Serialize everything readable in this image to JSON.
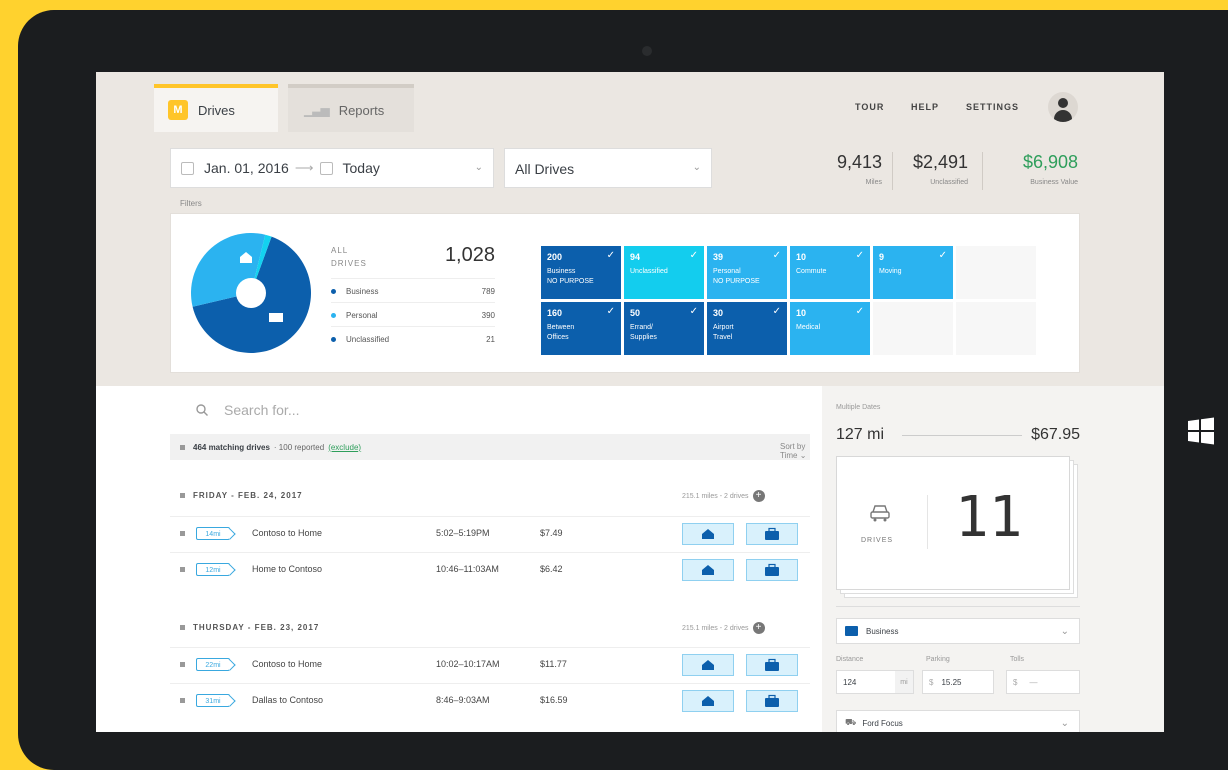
{
  "tabs": [
    {
      "label": "Drives",
      "badge": "M",
      "active": true
    },
    {
      "label": "Reports",
      "active": false
    }
  ],
  "nav": {
    "tour": "TOUR",
    "help": "HELP",
    "settings": "SETTINGS"
  },
  "filters": {
    "start_date": "Jan. 01, 2016",
    "end_date": "Today",
    "drive_filter": "All Drives",
    "label": "Filters"
  },
  "stats": [
    {
      "value": "9,413",
      "label": "Miles"
    },
    {
      "value": "$2,491",
      "label": "Unclassified"
    },
    {
      "value": "$6,908",
      "label": "Business Value"
    }
  ],
  "summary": {
    "all_drives_label_1": "ALL",
    "all_drives_label_2": "DRIVES",
    "total": "1,028",
    "legend": [
      {
        "label": "Business",
        "count": "789",
        "color": "#0C5FAC"
      },
      {
        "label": "Personal",
        "count": "390",
        "color": "#2BB3F0"
      },
      {
        "label": "Unclassified",
        "count": "21",
        "color": "#0C5FAC"
      }
    ],
    "pie": [
      {
        "label": "Business",
        "value": 789,
        "color": "#0C5FAC"
      },
      {
        "label": "Personal",
        "value": 390,
        "color": "#2BB3F0"
      },
      {
        "label": "Unclassified",
        "value": 21,
        "color": "#13D2F0"
      }
    ]
  },
  "tiles": [
    {
      "num": "200",
      "line1": "Business",
      "line2": "NO PURPOSE",
      "color": "#0C5FAC"
    },
    {
      "num": "94",
      "line1": "Unclassified",
      "line2": "",
      "color": "#13CDEE"
    },
    {
      "num": "39",
      "line1": "Personal",
      "line2": "NO PURPOSE",
      "color": "#2BB3F0"
    },
    {
      "num": "10",
      "line1": "Commute",
      "line2": "",
      "color": "#2BB3F0"
    },
    {
      "num": "9",
      "line1": "Moving",
      "line2": "",
      "color": "#2BB3F0"
    },
    {
      "num": "160",
      "line1": "Between",
      "line2": "Offices",
      "color": "#0C5FAC"
    },
    {
      "num": "50",
      "line1": "Errand/",
      "line2": "Supplies",
      "color": "#0C5FAC"
    },
    {
      "num": "30",
      "line1": "Airport",
      "line2": "Travel",
      "color": "#0C5FAC"
    },
    {
      "num": "10",
      "line1": "Medical",
      "line2": "",
      "color": "#2BB3F0"
    }
  ],
  "search": {
    "placeholder": "Search for..."
  },
  "matching": {
    "count_text": "464 matching drives",
    "reported_text": "· 100 reported",
    "exclude": "(exclude)",
    "sort": "Sort by Time"
  },
  "days": [
    {
      "header": "FRIDAY - FEB. 24, 2017",
      "meta": "215.1 miles - 2 drives",
      "drives": [
        {
          "miles": "14mi",
          "route": "Contoso to Home",
          "time": "5:02–5:19PM",
          "amount": "$7.49"
        },
        {
          "miles": "12mi",
          "route": "Home to Contoso",
          "time": "10:46–11:03AM",
          "amount": "$6.42"
        }
      ]
    },
    {
      "header": "THURSDAY - FEB. 23, 2017",
      "meta": "215.1 miles - 2 drives",
      "drives": [
        {
          "miles": "22mi",
          "route": "Contoso to Home",
          "time": "10:02–10:17AM",
          "amount": "$11.77"
        },
        {
          "miles": "31mi",
          "route": "Dallas to Contoso",
          "time": "8:46–9:03AM",
          "amount": "$16.59"
        }
      ]
    }
  ],
  "panel": {
    "title": "Multiple Dates",
    "miles": "127 mi",
    "value": "$67.95",
    "drives_label": "DRIVES",
    "drives_count": "11",
    "category": "Business",
    "distance_label": "Distance",
    "parking_label": "Parking",
    "tolls_label": "Tolls",
    "distance_value": "124",
    "distance_unit": "mi",
    "parking_value": "15.25",
    "parking_prefix": "$",
    "tolls_prefix": "$",
    "tolls_value": "—",
    "vehicle": "Ford Focus"
  },
  "colors": {
    "accent": "#FFC529",
    "business": "#0C5FAC",
    "personal": "#2BB3F0",
    "unclassified": "#13D2F0",
    "value_green": "#2E9E5B"
  }
}
